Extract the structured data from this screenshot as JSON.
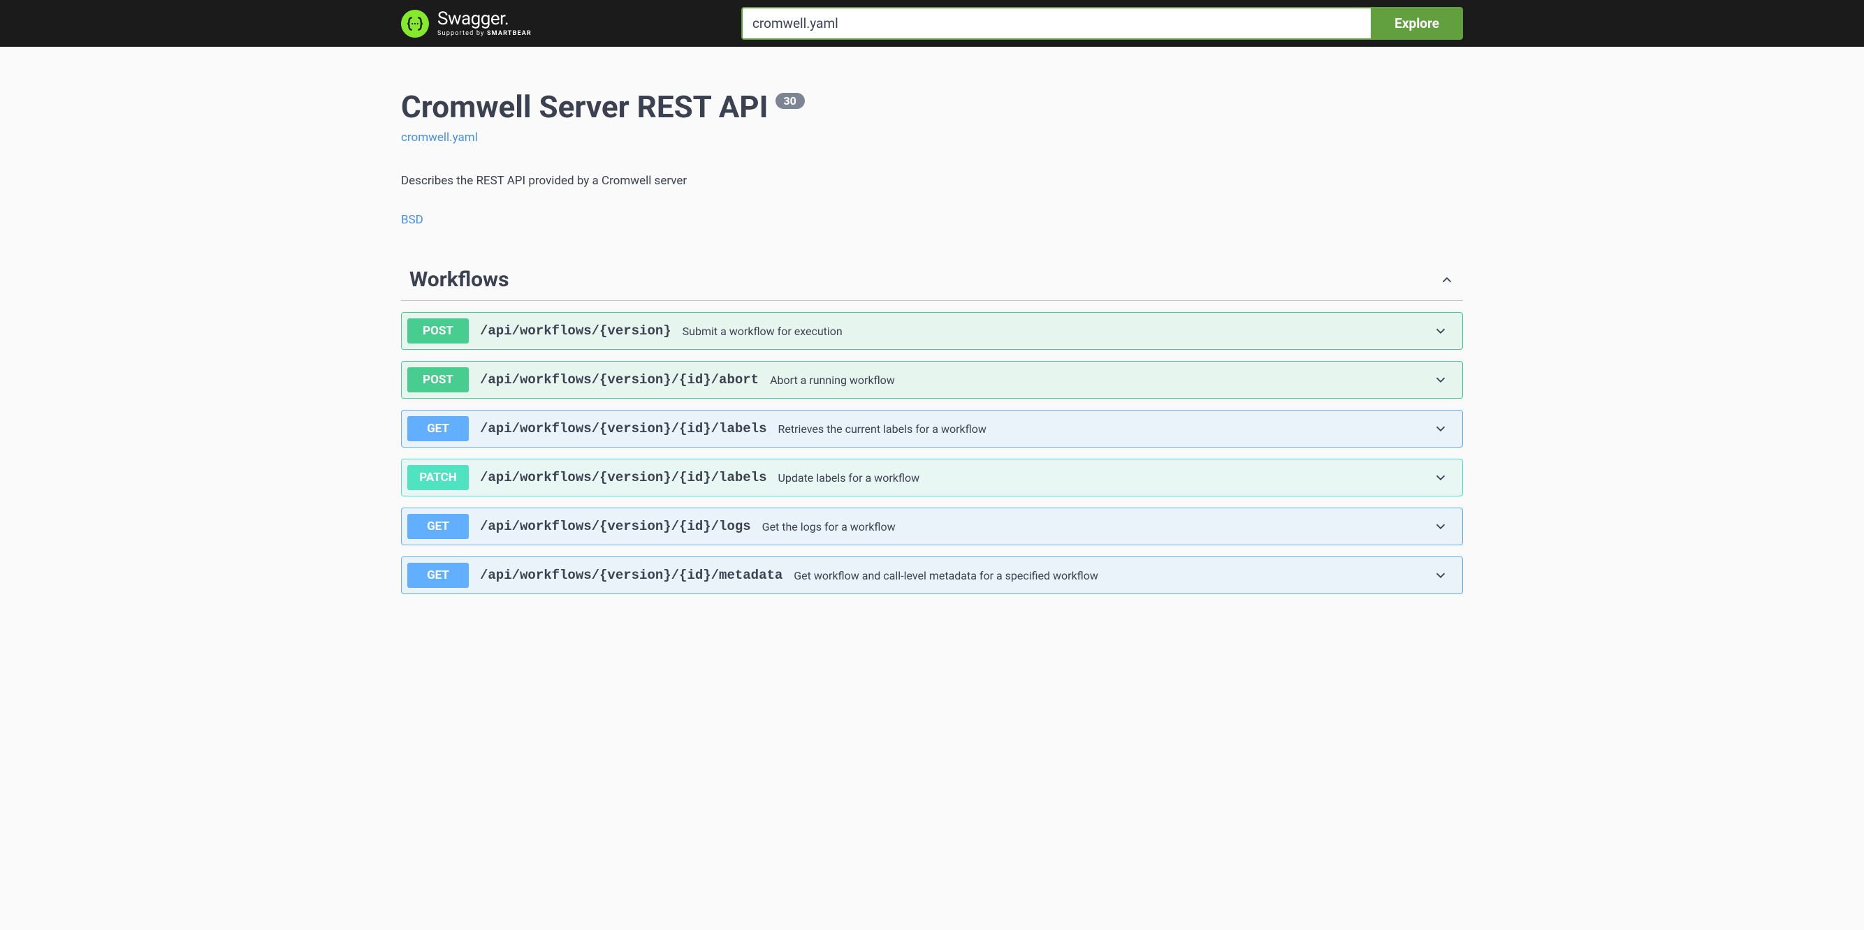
{
  "header": {
    "logo_main": "Swagger.",
    "logo_sub_prefix": "Supported by ",
    "logo_sub_brand": "SMARTBEAR",
    "url_value": "cromwell.yaml",
    "explore_label": "Explore"
  },
  "info": {
    "title": "Cromwell Server REST API",
    "version": "30",
    "spec_link": "cromwell.yaml",
    "description": "Describes the REST API provided by a Cromwell server",
    "license": "BSD"
  },
  "tag": {
    "name": "Workflows"
  },
  "methods": {
    "post": "POST",
    "get": "GET",
    "patch": "PATCH"
  },
  "colors": {
    "post": "#49cc90",
    "get": "#61affe",
    "patch": "#50e3c2",
    "accent": "#62a03f",
    "link": "#4990e2"
  },
  "operations": [
    {
      "method": "post",
      "path": "/api/workflows/{version}",
      "summary": "Submit a workflow for execution"
    },
    {
      "method": "post",
      "path": "/api/workflows/{version}/{id}/abort",
      "summary": "Abort a running workflow"
    },
    {
      "method": "get",
      "path": "/api/workflows/{version}/{id}/labels",
      "summary": "Retrieves the current labels for a workflow"
    },
    {
      "method": "patch",
      "path": "/api/workflows/{version}/{id}/labels",
      "summary": "Update labels for a workflow"
    },
    {
      "method": "get",
      "path": "/api/workflows/{version}/{id}/logs",
      "summary": "Get the logs for a workflow"
    },
    {
      "method": "get",
      "path": "/api/workflows/{version}/{id}/metadata",
      "summary": "Get workflow and call-level metadata for a specified workflow"
    }
  ]
}
